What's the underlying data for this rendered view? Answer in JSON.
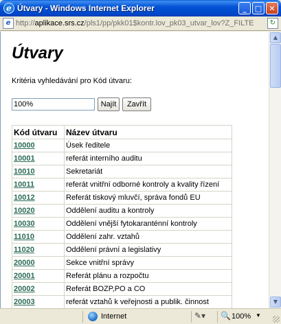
{
  "window": {
    "title": "Útvary - Windows Internet Explorer",
    "minimize_glyph": "_",
    "maximize_glyph": "□",
    "close_glyph": "✕"
  },
  "address": {
    "prefix": "http://",
    "host": "aplikace.srs.cz",
    "path": "/pls1/pp/pkk01$kontr.lov_pk03_utvar_lov?Z_FILTE"
  },
  "page": {
    "title": "Útvary",
    "criteria_label": "Kritéria vyhledávání pro Kód útvaru:",
    "search_value": "100%",
    "find_button": "Najít",
    "close_button": "Zavřít"
  },
  "table": {
    "headers": [
      "Kód útvaru",
      "Název útvaru"
    ],
    "rows": [
      {
        "code": "10000",
        "name": "Úsek ředitele"
      },
      {
        "code": "10001",
        "name": "referát interního auditu"
      },
      {
        "code": "10010",
        "name": "Sekretariát"
      },
      {
        "code": "10011",
        "name": "referát vnitřní odborné kontroly a kvality řízení"
      },
      {
        "code": "10012",
        "name": "Referát tiskový mluvčí, správa fondů EU"
      },
      {
        "code": "10020",
        "name": "Oddělení auditu a kontroly"
      },
      {
        "code": "10030",
        "name": "Oddělení vnější fytokaranténní kontroly"
      },
      {
        "code": "11010",
        "name": "Oddělení zahr. vztahů"
      },
      {
        "code": "11020",
        "name": "Oddělení právní a legislativy"
      },
      {
        "code": "20000",
        "name": "Sekce vnitřní správy"
      },
      {
        "code": "20001",
        "name": "Referát plánu a rozpočtu"
      },
      {
        "code": "20002",
        "name": "Referát BOZP,PO a CO"
      },
      {
        "code": "20003",
        "name": "referát vztahů k veřejnosti a publik. činnost"
      }
    ]
  },
  "status": {
    "zone": "Internet",
    "zoom": "100%"
  },
  "colors": {
    "link": "#2a6a55",
    "titlebar": "#0454d6"
  }
}
